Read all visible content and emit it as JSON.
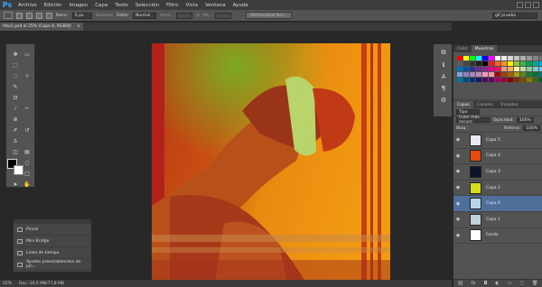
{
  "app": {
    "logo": "Ps"
  },
  "menu": [
    "Archivo",
    "Edición",
    "Imagen",
    "Capa",
    "Texto",
    "Selección",
    "Filtro",
    "Vista",
    "Ventana",
    "Ayuda"
  ],
  "options": {
    "feather_label": "Desv.:",
    "feather_value": "0 px",
    "smooth_label": "Suavizar",
    "style_label": "Estilo:",
    "style_value": "Normal",
    "width_label": "Anch.:",
    "height_label": "Alt.:",
    "refine_button": "Perfeccionar bor...",
    "workspace_value": "gif prueba"
  },
  "document": {
    "tab_title": "foto1.psd al 25% (Capa 6, RGB/8)",
    "close_glyph": "×"
  },
  "mini_panel": {
    "items": [
      {
        "label": "Pincel",
        "icon": "brush-panel-icon"
      },
      {
        "label": "Mini Bridge",
        "icon": "mini-bridge-icon"
      },
      {
        "label": "Línea de tiempo",
        "icon": "timeline-icon"
      },
      {
        "label": "Ajustes preestablecidos de pin...",
        "icon": "brush-presets-icon"
      }
    ]
  },
  "status": {
    "zoom": "25%",
    "doc_size": "Doc: 16,0 MB/77,8 MB"
  },
  "swatches_panel": {
    "tabs": [
      "Color",
      "Muestras"
    ],
    "active_tab": "Muestras"
  },
  "layers_panel": {
    "tabs": [
      "Capas",
      "Canales",
      "Trazados"
    ],
    "active_tab": "Capas",
    "kind_label": "Tipo",
    "blend_mode": "Color más oscuro",
    "opacity_label": "Opacidad:",
    "opacity_value": "100%",
    "lock_label": "Bloq.:",
    "fill_label": "Relleno:",
    "fill_value": "100%",
    "layers": [
      {
        "name": "Capa 5",
        "thumb_color": "#e8e8f0",
        "selected": false
      },
      {
        "name": "Capa 4",
        "thumb_color": "#e74a10",
        "selected": false
      },
      {
        "name": "Capa 3",
        "thumb_color": "#10142a",
        "selected": false
      },
      {
        "name": "Capa 2",
        "thumb_color": "#d2dc18",
        "selected": false
      },
      {
        "name": "Capa 6",
        "thumb_color": "#bcd4e8",
        "selected": true
      },
      {
        "name": "Capa 1",
        "thumb_color": "#c0d0d8",
        "selected": false
      },
      {
        "name": "Fondo",
        "thumb_color": "#ffffff",
        "selected": false
      }
    ],
    "footer_icons": [
      "link-icon",
      "fx-icon",
      "mask-icon",
      "adjustment-icon",
      "folder-icon",
      "new-layer-icon",
      "trash-icon"
    ],
    "footer_glyphs": [
      "⛓",
      "fx",
      "◘",
      "◐",
      "▭",
      "▢",
      "🗑"
    ]
  },
  "colors": {
    "foreground": "#000000",
    "background": "#ffffff",
    "selected_layer": "#4e6f9a"
  }
}
